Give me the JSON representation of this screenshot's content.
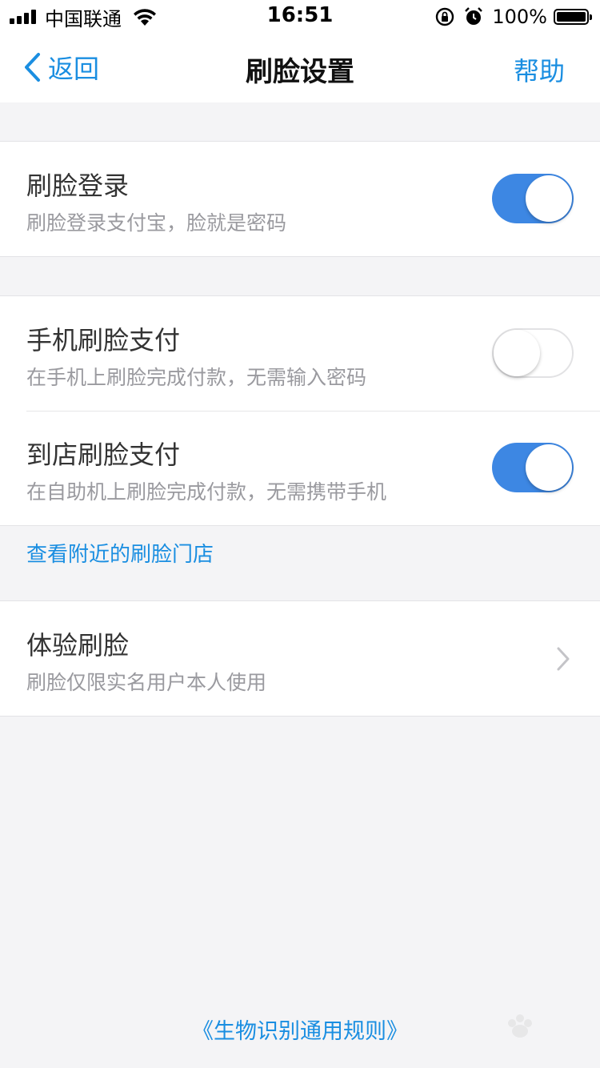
{
  "status_bar": {
    "carrier": "中国联通",
    "time": "16:51",
    "battery_percent": "100%"
  },
  "nav": {
    "back_label": "返回",
    "title": "刷脸设置",
    "help_label": "帮助"
  },
  "settings": {
    "face_login": {
      "title": "刷脸登录",
      "subtitle": "刷脸登录支付宝，脸就是密码",
      "enabled": true
    },
    "phone_face_pay": {
      "title": "手机刷脸支付",
      "subtitle": "在手机上刷脸完成付款，无需输入密码",
      "enabled": false
    },
    "store_face_pay": {
      "title": "到店刷脸支付",
      "subtitle": "在自助机上刷脸完成付款，无需携带手机",
      "enabled": true
    },
    "nearby_stores_link": "查看附近的刷脸门店",
    "try_face": {
      "title": "体验刷脸",
      "subtitle": "刷脸仅限实名用户本人使用"
    }
  },
  "footer": {
    "rules_link": "《生物识别通用规则》"
  },
  "colors": {
    "accent": "#1a8ee1",
    "toggle_on": "#3d87e3",
    "background": "#f4f4f6"
  },
  "icons": [
    "signal-icon",
    "wifi-icon",
    "orientation-lock-icon",
    "alarm-icon",
    "battery-icon",
    "chevron-left-icon",
    "chevron-right-icon"
  ]
}
